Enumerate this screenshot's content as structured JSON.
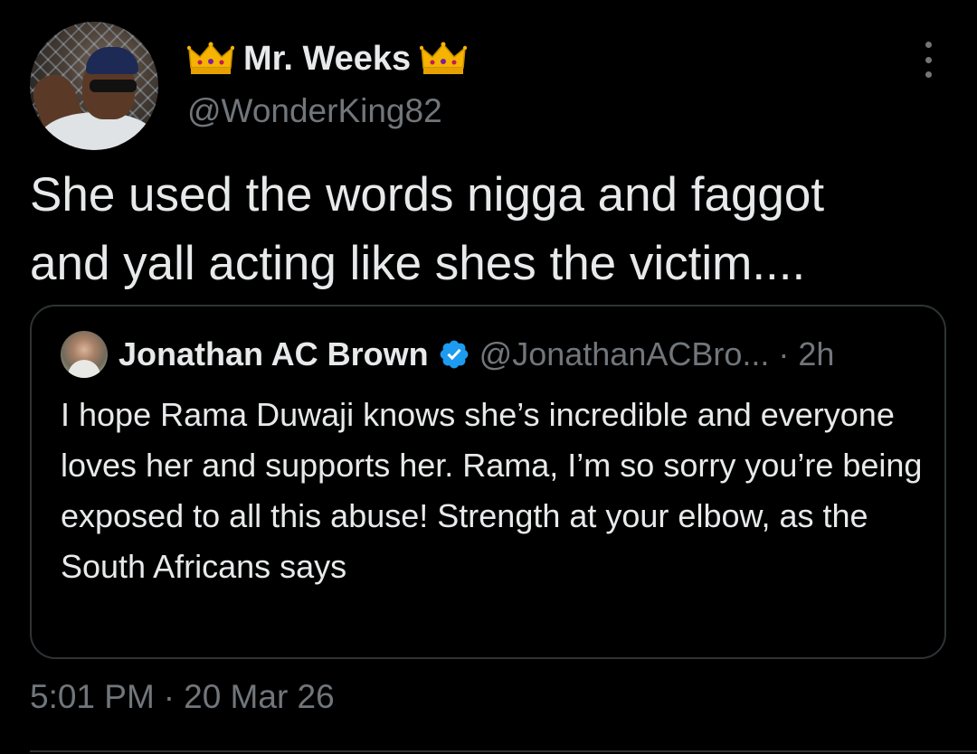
{
  "author": {
    "display_name": "Mr. Weeks",
    "handle": "@WonderKing82",
    "avatar_icon": "profile-photo",
    "name_emoji": "crown-icon"
  },
  "tweet": {
    "text": "She used the words nigga and faggot\nand yall acting like shes the victim....",
    "time": "5:01 PM",
    "separator": "·",
    "date": "20 Mar 26"
  },
  "quoted_tweet": {
    "display_name": "Jonathan AC Brown",
    "verified": true,
    "handle": "@JonathanACBro...",
    "separator": "·",
    "age": "2h",
    "text": "I hope Rama Duwaji knows she’s incredible and everyone loves her and supports her. Rama, I’m so sorry you’re being exposed to all this abuse! Strength at your elbow, as the South Africans says"
  },
  "colors": {
    "background": "#000000",
    "primary_text": "#e7e9ea",
    "secondary_text": "#71767b",
    "border": "#2f3336",
    "verified_blue": "#1d9bf0",
    "crown_gold": "#f4b400"
  }
}
